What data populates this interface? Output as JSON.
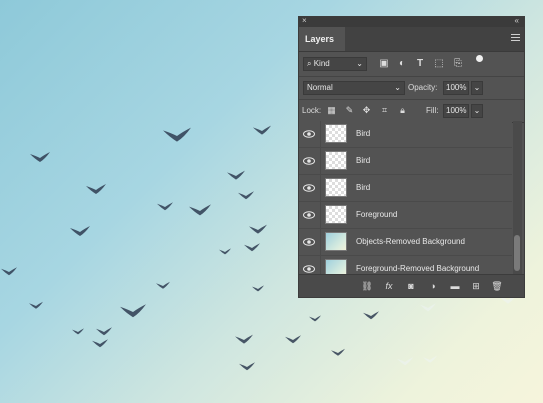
{
  "panel": {
    "close_glyph": "×",
    "collapse_glyph": "«",
    "tab": "Layers"
  },
  "filter": {
    "kind_label": "Kind",
    "icons": [
      "image-filter-icon",
      "adjustment-filter-icon",
      "type-filter-icon",
      "shape-filter-icon",
      "smart-object-filter-icon",
      "filter-toggle-icon"
    ]
  },
  "blend": {
    "mode": "Normal",
    "opacity_label": "Opacity:",
    "opacity_value": "100%"
  },
  "lock": {
    "label": "Lock:",
    "fill_label": "Fill:",
    "fill_value": "100%"
  },
  "layers": [
    {
      "name": "Bird",
      "thumb": "transparent"
    },
    {
      "name": "Bird",
      "thumb": "transparent"
    },
    {
      "name": "Bird",
      "thumb": "transparent"
    },
    {
      "name": "Foreground",
      "thumb": "transparent"
    },
    {
      "name": "Objects-Removed Background",
      "thumb": "photo"
    },
    {
      "name": "Foreground-Removed Background",
      "thumb": "photo"
    }
  ],
  "bottom_icons": [
    "link-layers-icon",
    "fx-icon",
    "add-mask-icon",
    "adjustment-layer-icon",
    "new-group-icon",
    "new-layer-icon",
    "delete-layer-icon"
  ],
  "colors": {
    "panel_bg": "#535353",
    "panel_dark": "#424242",
    "text": "#e6e6e6"
  }
}
